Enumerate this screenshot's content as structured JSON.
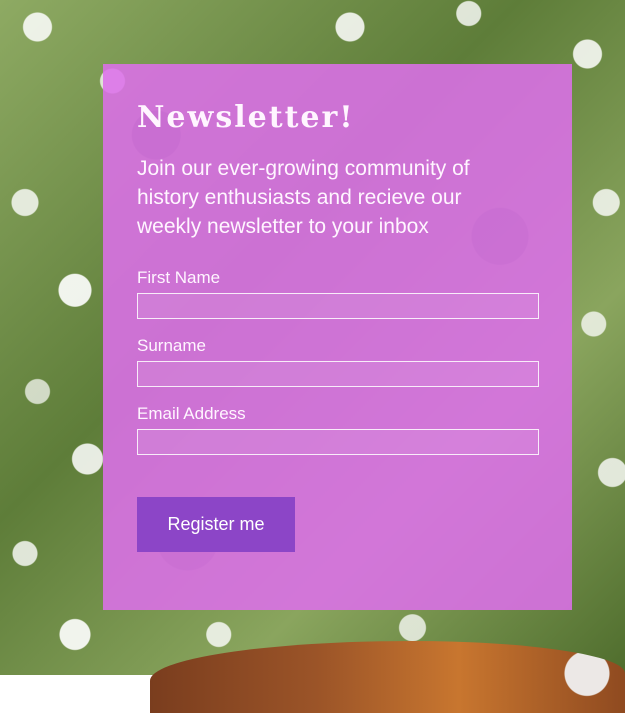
{
  "newsletter": {
    "title": "Newsletter!",
    "intro": "Join our ever-growing community of history enthusiasts and recieve our weekly newsletter to your inbox",
    "fields": [
      {
        "label": "First Name",
        "value": "",
        "placeholder": ""
      },
      {
        "label": "Surname",
        "value": "",
        "placeholder": ""
      },
      {
        "label": "Email Address",
        "value": "",
        "placeholder": ""
      }
    ],
    "button_label": "Register me"
  },
  "colors": {
    "card_background": "#dd6fea",
    "button_background": "#8c45c7",
    "text": "#fff5ff"
  }
}
